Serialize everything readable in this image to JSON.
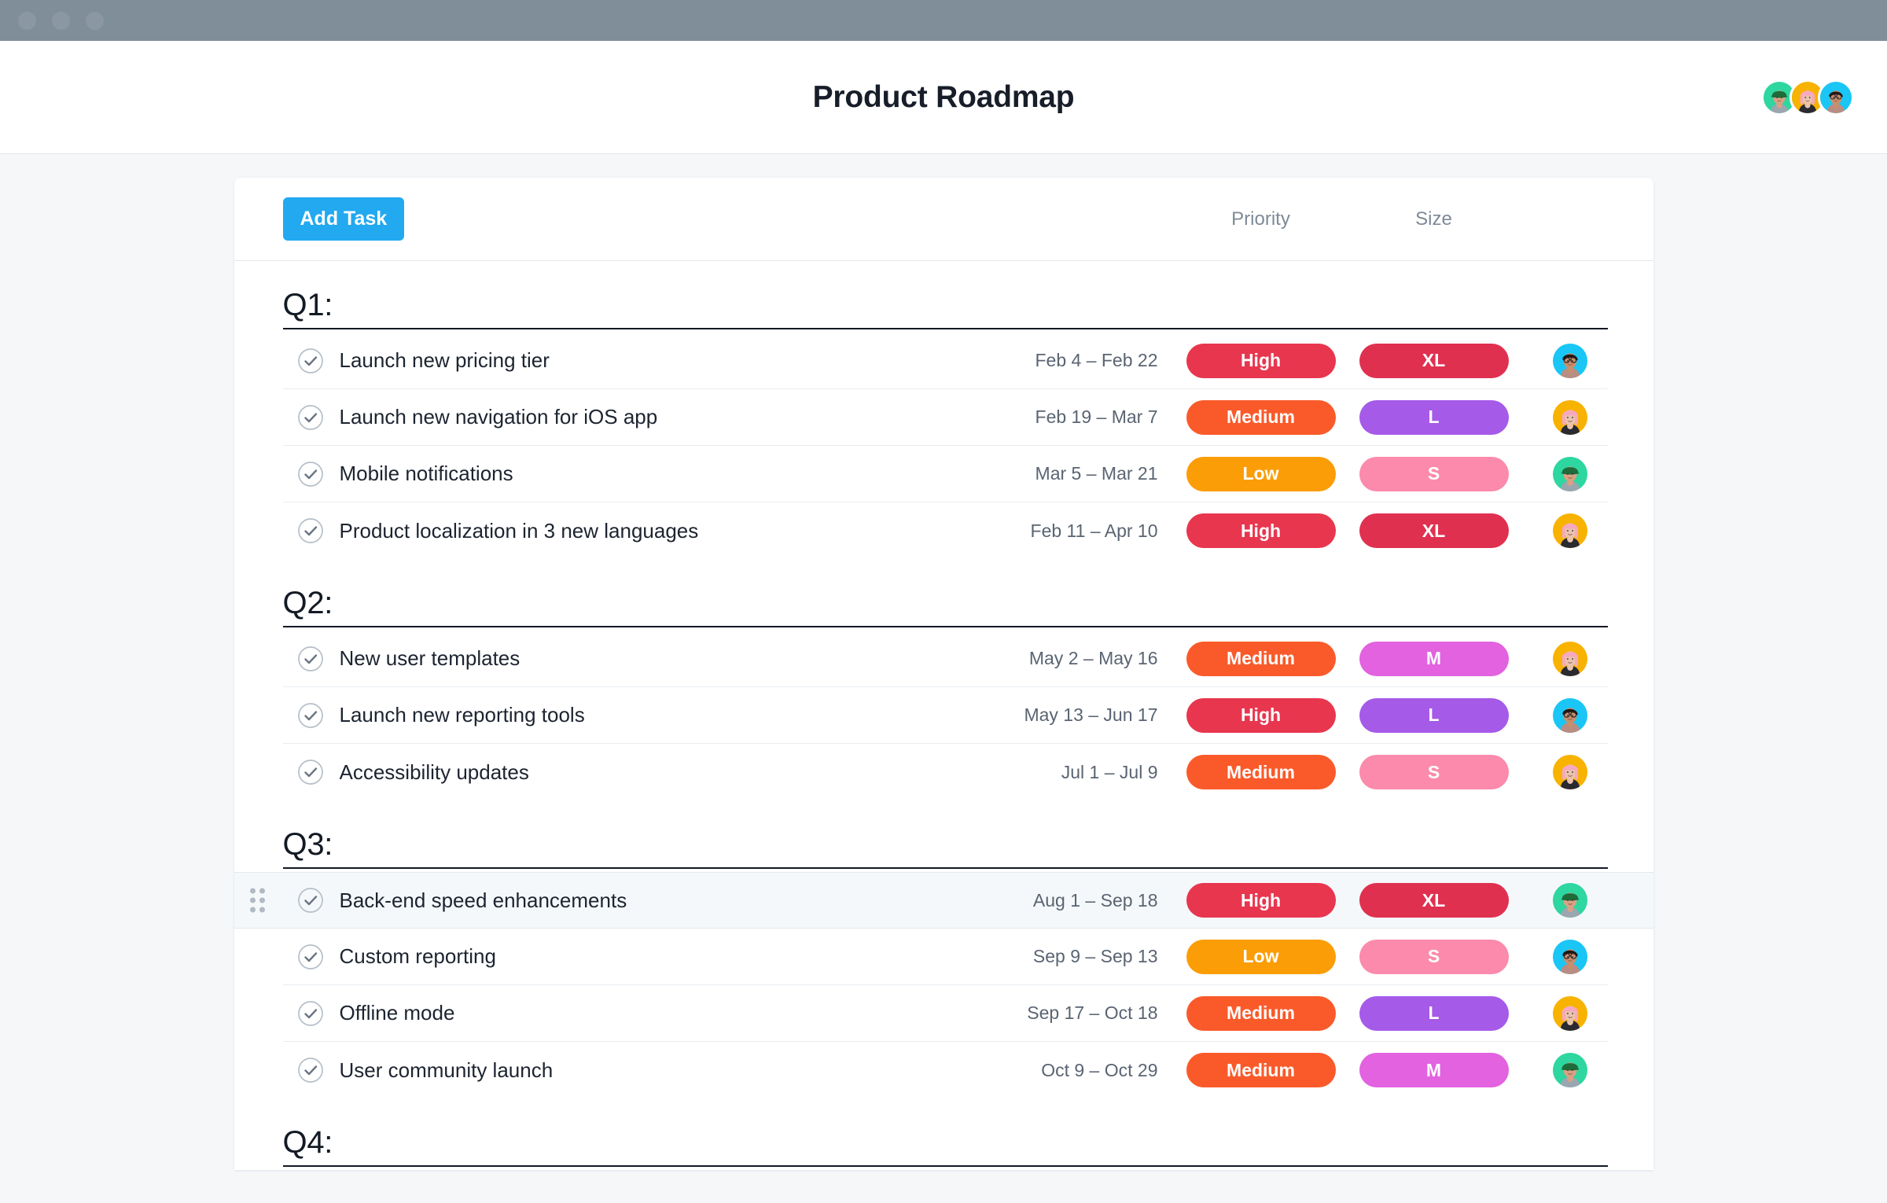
{
  "browser": {
    "dots": [
      "window-dot-1",
      "window-dot-2",
      "window-dot-3"
    ]
  },
  "header": {
    "title": "Product Roadmap",
    "members": [
      {
        "name": "member-avatar-green",
        "color": "#2ed6a0"
      },
      {
        "name": "member-avatar-gold",
        "color": "#f8b200"
      },
      {
        "name": "member-avatar-cyan",
        "color": "#19c6f5"
      }
    ]
  },
  "toolbar": {
    "add_task_label": "Add Task",
    "priority_header": "Priority",
    "size_header": "Size",
    "owner_header": ""
  },
  "colors": {
    "accent": "#22a9f0",
    "priority_high": "#e8364f",
    "priority_medium": "#fa5a2a",
    "priority_low": "#fb9d06",
    "size_xl": "#e03050",
    "size_l": "#a55ae8",
    "size_m": "#e262e0",
    "size_s": "#fb8aac",
    "avatar_green": "#2ed6a0",
    "avatar_gold": "#f8b200",
    "avatar_cyan": "#19c6f5"
  },
  "sections": [
    {
      "title": "Q1:",
      "tasks": [
        {
          "name": "Launch new pricing tier",
          "dates": "Feb 4 – Feb 22",
          "priority": "High",
          "priority_color": "#e8364f",
          "size": "XL",
          "size_color": "#e03050",
          "owner": "cyan",
          "checked": true,
          "active": false
        },
        {
          "name": "Launch new navigation for iOS app",
          "dates": "Feb 19 – Mar 7",
          "priority": "Medium",
          "priority_color": "#fa5a2a",
          "size": "L",
          "size_color": "#a55ae8",
          "owner": "gold",
          "checked": true,
          "active": false
        },
        {
          "name": "Mobile notifications",
          "dates": "Mar 5 – Mar 21",
          "priority": "Low",
          "priority_color": "#fb9d06",
          "size": "S",
          "size_color": "#fb8aac",
          "owner": "green",
          "checked": true,
          "active": false
        },
        {
          "name": "Product localization in 3 new languages",
          "dates": "Feb 11 – Apr 10",
          "priority": "High",
          "priority_color": "#e8364f",
          "size": "XL",
          "size_color": "#e03050",
          "owner": "gold",
          "checked": true,
          "active": false
        }
      ]
    },
    {
      "title": "Q2:",
      "tasks": [
        {
          "name": "New user templates",
          "dates": "May 2 – May 16",
          "priority": "Medium",
          "priority_color": "#fa5a2a",
          "size": "M",
          "size_color": "#e262e0",
          "owner": "gold",
          "checked": true,
          "active": false
        },
        {
          "name": "Launch new reporting tools",
          "dates": "May 13 – Jun 17",
          "priority": "High",
          "priority_color": "#e8364f",
          "size": "L",
          "size_color": "#a55ae8",
          "owner": "cyan",
          "checked": true,
          "active": false
        },
        {
          "name": "Accessibility updates",
          "dates": "Jul 1 – Jul 9",
          "priority": "Medium",
          "priority_color": "#fa5a2a",
          "size": "S",
          "size_color": "#fb8aac",
          "owner": "gold",
          "checked": true,
          "active": false
        }
      ]
    },
    {
      "title": "Q3:",
      "tasks": [
        {
          "name": "Back-end speed enhancements",
          "dates": "Aug 1 – Sep 18",
          "priority": "High",
          "priority_color": "#e8364f",
          "size": "XL",
          "size_color": "#e03050",
          "owner": "green",
          "checked": true,
          "active": true
        },
        {
          "name": "Custom reporting",
          "dates": "Sep 9 – Sep 13",
          "priority": "Low",
          "priority_color": "#fb9d06",
          "size": "S",
          "size_color": "#fb8aac",
          "owner": "cyan",
          "checked": true,
          "active": false
        },
        {
          "name": "Offline mode",
          "dates": "Sep 17 – Oct 18",
          "priority": "Medium",
          "priority_color": "#fa5a2a",
          "size": "L",
          "size_color": "#a55ae8",
          "owner": "gold",
          "checked": true,
          "active": false
        },
        {
          "name": "User community launch",
          "dates": "Oct 9 – Oct 29",
          "priority": "Medium",
          "priority_color": "#fa5a2a",
          "size": "M",
          "size_color": "#e262e0",
          "owner": "green",
          "checked": true,
          "active": false
        }
      ]
    },
    {
      "title": "Q4:",
      "tasks": []
    }
  ]
}
